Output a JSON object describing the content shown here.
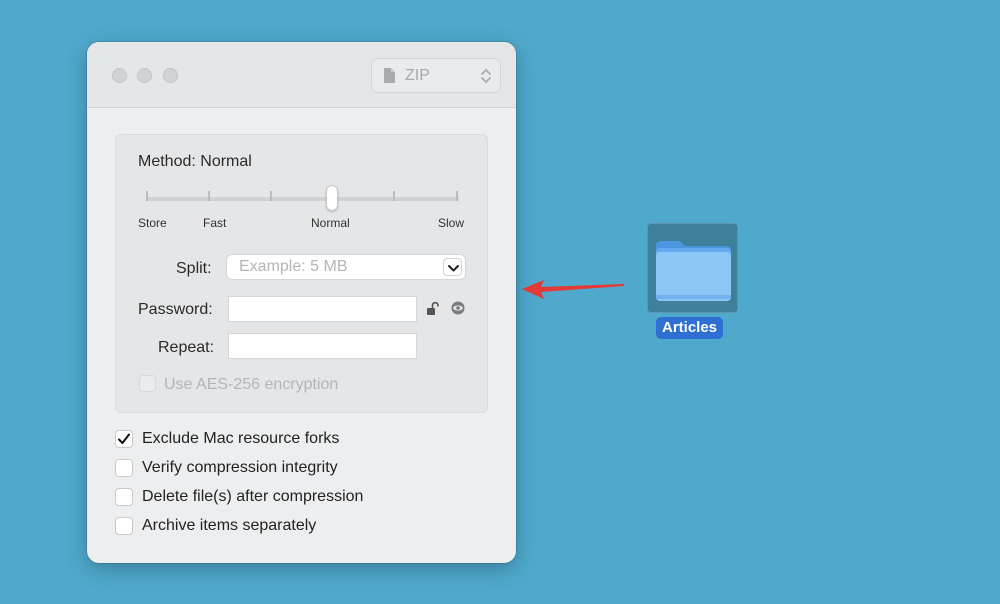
{
  "format": {
    "label": "ZIP"
  },
  "method": {
    "label": "Method: Normal",
    "ticks": [
      "Store",
      "Fast",
      "Normal",
      "Slow"
    ],
    "level": "Normal"
  },
  "split": {
    "label": "Split:",
    "placeholder": "Example: 5 MB"
  },
  "password": {
    "label": "Password:",
    "value": ""
  },
  "repeat": {
    "label": "Repeat:",
    "value": ""
  },
  "aes": {
    "label": "Use AES-256 encryption",
    "checked": false,
    "disabled": true
  },
  "options": [
    {
      "label": "Exclude Mac resource forks",
      "checked": true
    },
    {
      "label": "Verify compression integrity",
      "checked": false
    },
    {
      "label": "Delete file(s) after compression",
      "checked": false
    },
    {
      "label": "Archive items separately",
      "checked": false
    }
  ],
  "desktop": {
    "folder_label": "Articles"
  },
  "colors": {
    "desktop": "#4fa9cc",
    "selection": "#2f6fd1",
    "arrow": "#e53935"
  }
}
